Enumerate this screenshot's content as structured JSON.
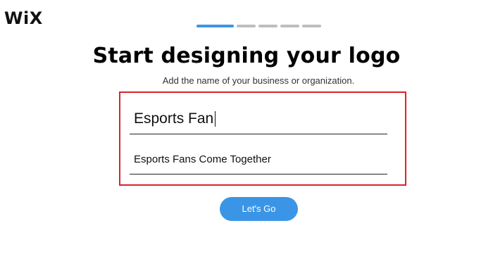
{
  "brand": {
    "logo_text": "WiX"
  },
  "progress": {
    "total_steps": 5,
    "current_step": 1
  },
  "heading": {
    "title": "Start designing your logo",
    "subtitle": "Add the name of your business or organization."
  },
  "form": {
    "business_name": {
      "value": "Esports Fan"
    },
    "tagline": {
      "value": "Esports Fans Come Together"
    },
    "highlight_color": "#d8232a"
  },
  "cta": {
    "label": "Let's Go",
    "color": "#3b95e6"
  },
  "colors": {
    "accent": "#3b95e6",
    "inactive_step": "#bdbdbd"
  }
}
